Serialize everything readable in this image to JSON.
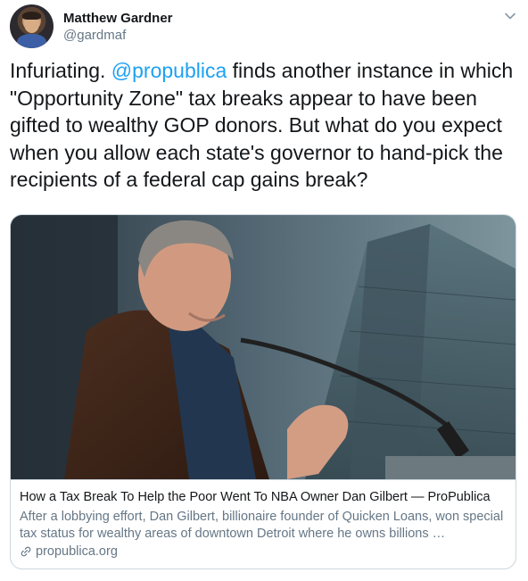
{
  "author": {
    "display_name": "Matthew Gardner",
    "handle": "@gardmaf",
    "avatar_icon": "person-avatar-icon"
  },
  "menu_icon": "chevron-down-icon",
  "tweet": {
    "text_before_mention": "Infuriating. ",
    "mention": "@propublica",
    "text_after_mention": " finds another instance in which \"Opportunity Zone\" tax breaks appear to have been gifted to wealthy GOP donors. But what do you expect when you allow each state's governor to hand-pick the recipients of a federal cap gains break?"
  },
  "link_card": {
    "title": "How a Tax Break To Help the Poor Went To NBA Owner Dan Gilbert — ProPublica",
    "description": "After a lobbying effort, Dan Gilbert, billionaire founder of Quicken Loans, won special tax status for wealthy areas of downtown Detroit where he owns billions …",
    "domain": "propublica.org",
    "domain_icon": "link-icon"
  },
  "colors": {
    "link_blue": "#1da1f2",
    "text_primary": "#14171a",
    "text_secondary": "#657786",
    "border": "#ccd6dd"
  }
}
